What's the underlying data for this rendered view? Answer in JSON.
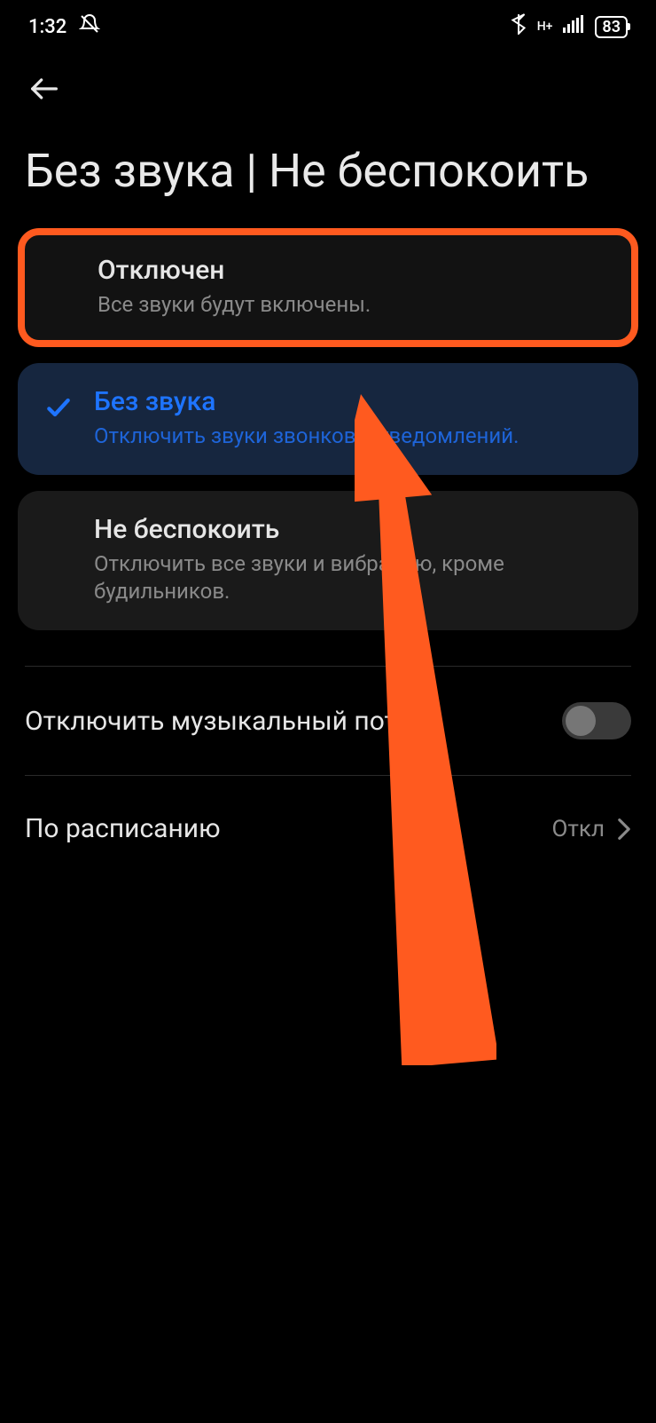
{
  "status_bar": {
    "time": "1:32",
    "battery": "83"
  },
  "page": {
    "title": "Без звука | Не беспокоить"
  },
  "options": [
    {
      "title": "Отключен",
      "subtitle": "Все звуки будут включены."
    },
    {
      "title": "Без звука",
      "subtitle": "Отключить звуки звонков и уведомлений."
    },
    {
      "title": "Не беспокоить",
      "subtitle": "Отключить все звуки и вибрацию, кроме будильников."
    }
  ],
  "settings": {
    "mute_stream_label": "Отключить музыкальный поток",
    "schedule_label": "По расписанию",
    "schedule_value": "Откл"
  }
}
